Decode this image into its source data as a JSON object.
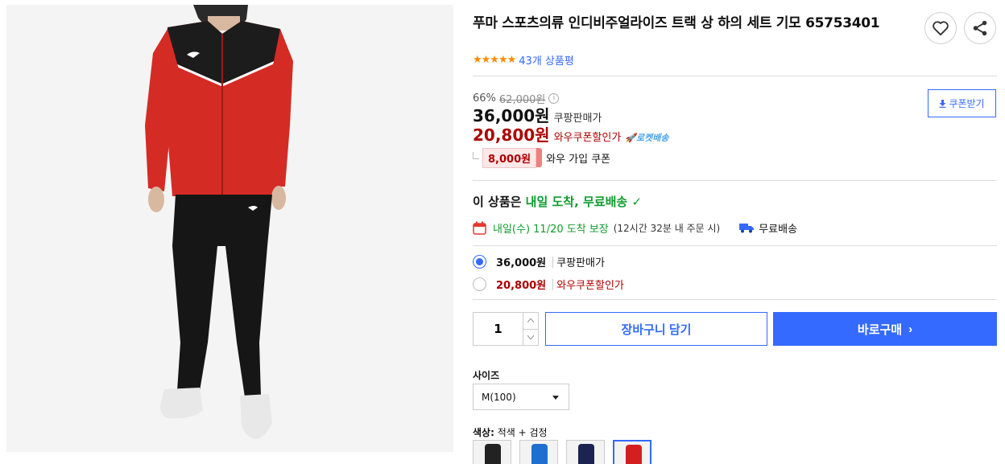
{
  "product": {
    "title": "푸마 스포츠의류 인디비주얼라이즈 트랙 상 하의 세트 기모 65753401",
    "rating_stars": "★★★★★",
    "review_text": "43개 상품평"
  },
  "actions": {
    "wishlist_icon": "heart-icon",
    "share_icon": "share-icon"
  },
  "pricing": {
    "discount_rate": "66%",
    "original_price": "62,000원",
    "info_glyph": "i",
    "sale_price": "36,000원",
    "sale_label": "쿠팡판매가",
    "coupon_price": "20,800원",
    "coupon_label": "와우쿠폰할인가",
    "rocket_badge": "🚀로켓배송",
    "wow_coupon_amount": "8,000원",
    "wow_coupon_label": "와우 가입 쿠폰",
    "coupon_button": "쿠폰받기"
  },
  "delivery": {
    "headline_prefix": "이 상품은 ",
    "headline_green": "내일 도착, 무료배송",
    "check": "✓",
    "arrival": "내일(수) 11/20 도착 보장",
    "cutoff": "(12시간 32분 내 주문 시)",
    "shipping": "무료배송"
  },
  "price_options": [
    {
      "price": "36,000원",
      "label": "쿠팡판매가",
      "selected": true
    },
    {
      "price": "20,800원",
      "label": "와우쿠폰할인가",
      "selected": false
    }
  ],
  "purchase": {
    "quantity": "1",
    "cart_button": "장바구니 담기",
    "buy_button": "바로구매",
    "buy_chevron": "›"
  },
  "options": {
    "size_label": "사이즈",
    "size_value": "M(100)",
    "color_label": "색상:",
    "color_value": "적색 + 검정",
    "swatches": [
      "#222222",
      "#1f6fd1",
      "#1b2450",
      "#d41f1f"
    ]
  },
  "colors": {
    "accent": "#346aff",
    "price_red": "#ae0000",
    "delivery_green": "#0f9c2e",
    "star": "#ff8a00"
  }
}
